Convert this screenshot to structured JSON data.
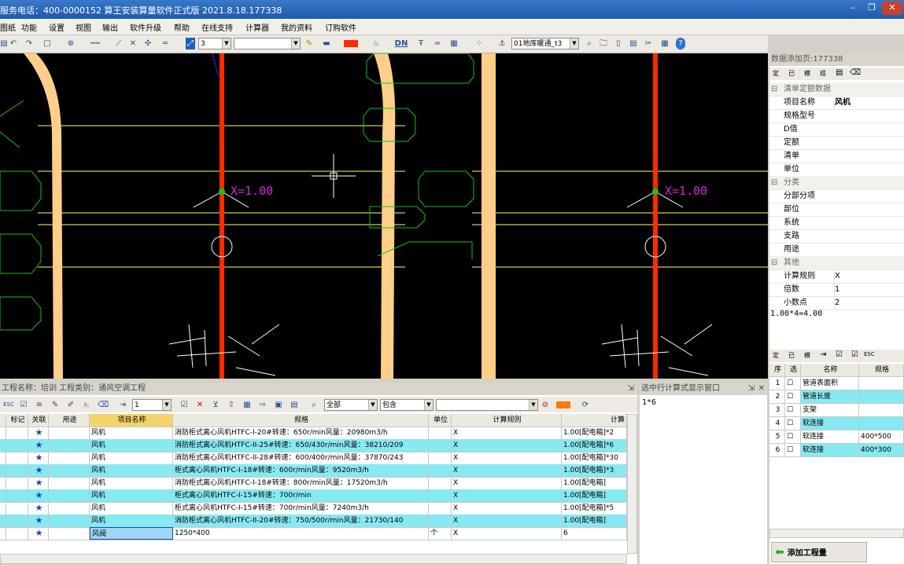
{
  "title": "服务电话：400-0000152   算王安装算量软件正式版 2021.8.18.177338",
  "window_controls": [
    "–",
    "❐",
    "✕"
  ],
  "menu": [
    "图纸",
    "功能",
    "设置",
    "视图",
    "输出",
    "软件升级",
    "帮助",
    "在线支持",
    "计算器",
    "我的资料",
    "订购软件"
  ],
  "toolbar": {
    "line_weight_value": "3",
    "layer_value": "",
    "color_swatch": "#ff2a00",
    "drawing_value": "01地库暖通_t3",
    "dn_label": "DN"
  },
  "cad": {
    "label_left": "X=1.00",
    "label_right": "X=1.00",
    "colors": {
      "pipe": "#ff2a00",
      "duct": "#ffcf8a",
      "line": "#ffff66",
      "outline": "#19c119",
      "label": "#d623d6"
    }
  },
  "right_panel": {
    "title": "数据添加页:177338",
    "tabs": [
      "定",
      "已",
      "模",
      "组"
    ],
    "sections": [
      {
        "name": "清单定额数据",
        "rows": [
          [
            "项目名称",
            "风机"
          ],
          [
            "规格型号",
            ""
          ],
          [
            "D值",
            ""
          ],
          [
            "定额",
            ""
          ],
          [
            "清单",
            ""
          ],
          [
            "单位",
            ""
          ]
        ]
      },
      {
        "name": "分类",
        "rows": [
          [
            "分部分项",
            ""
          ],
          [
            "部位",
            ""
          ],
          [
            "系统",
            ""
          ],
          [
            "支路",
            ""
          ],
          [
            "用途",
            ""
          ]
        ]
      },
      {
        "name": "其他",
        "rows": [
          [
            "计算规则",
            "X"
          ],
          [
            "倍数",
            "1"
          ],
          [
            "小数点",
            "2"
          ]
        ]
      }
    ],
    "expression": "1.00*4=4.00",
    "list_headers": [
      "序",
      "选",
      "名称",
      "规格"
    ],
    "list_rows": [
      {
        "no": "1",
        "name": "管道表面积",
        "spec": "",
        "hl": false
      },
      {
        "no": "2",
        "name": "管道长度",
        "spec": "",
        "hl": true
      },
      {
        "no": "3",
        "name": "支架",
        "spec": "",
        "hl": false
      },
      {
        "no": "4",
        "name": "软连接",
        "spec": "",
        "hl": true
      },
      {
        "no": "5",
        "name": "软连接",
        "spec": "400*500",
        "hl": false
      },
      {
        "no": "6",
        "name": "软连接",
        "spec": "400*300",
        "hl": true
      }
    ],
    "add_button": "添加工程量"
  },
  "bottom_panel": {
    "title": "工程名称：培训  工程类别：通风空调工程",
    "toolbar_num": "1",
    "filter_all": "全部",
    "filter_contains": "包含",
    "headers": [
      "标记",
      "关联",
      "用途",
      "项目名称",
      "规格",
      "单位",
      "计算规则",
      "计算"
    ],
    "rows": [
      {
        "name": "风机",
        "spec": "消防柜式离心风机HTFC-I-20#转速：650r/min风量：20980m3/h",
        "unit": "",
        "rule": "X",
        "calc": "1.00[配电箱]*2",
        "hl": false
      },
      {
        "name": "风机",
        "spec": "消防柜式离心风机HTFC-II-25#转速：650/430r/min风量：38210/209",
        "unit": "",
        "rule": "X",
        "calc": "1.00[配电箱]*6",
        "hl": true
      },
      {
        "name": "风机",
        "spec": "消防柜式离心风机HTFC-II-28#转速：600/400r/min风量：37870/243",
        "unit": "",
        "rule": "X",
        "calc": "1.00[配电箱]*30",
        "hl": false
      },
      {
        "name": "风机",
        "spec": "柜式离心风机HTFC-I-18#转速：600r/min风量：9520m3/h",
        "unit": "",
        "rule": "X",
        "calc": "1.00[配电箱]*3",
        "hl": true
      },
      {
        "name": "风机",
        "spec": "消防柜式离心风机HTFC-I-18#转速：800r/min风量：17520m3/h",
        "unit": "",
        "rule": "X",
        "calc": "1.00[配电箱]",
        "hl": false
      },
      {
        "name": "风机",
        "spec": "柜式离心风机HTFC-I-15#转速：700r/min",
        "unit": "",
        "rule": "X",
        "calc": "1.00[配电箱]",
        "hl": true
      },
      {
        "name": "风机",
        "spec": "柜式离心风机HTFC-I-15#转速：700r/min风量：7240m3/h",
        "unit": "",
        "rule": "X",
        "calc": "1.00[配电箱]*5",
        "hl": false
      },
      {
        "name": "风机",
        "spec": "消防柜式离心风机HTFC-II-20#转速：750/500r/min风量：21730/140",
        "unit": "",
        "rule": "X",
        "calc": "1.00[配电箱]",
        "hl": true
      },
      {
        "name": "风阀",
        "spec": "1250*400",
        "unit": "个",
        "rule": "X",
        "calc": "6",
        "hl": false,
        "selected": true
      }
    ]
  },
  "formula_panel": {
    "title": "选中行计算式显示窗口",
    "content": "1*6"
  }
}
